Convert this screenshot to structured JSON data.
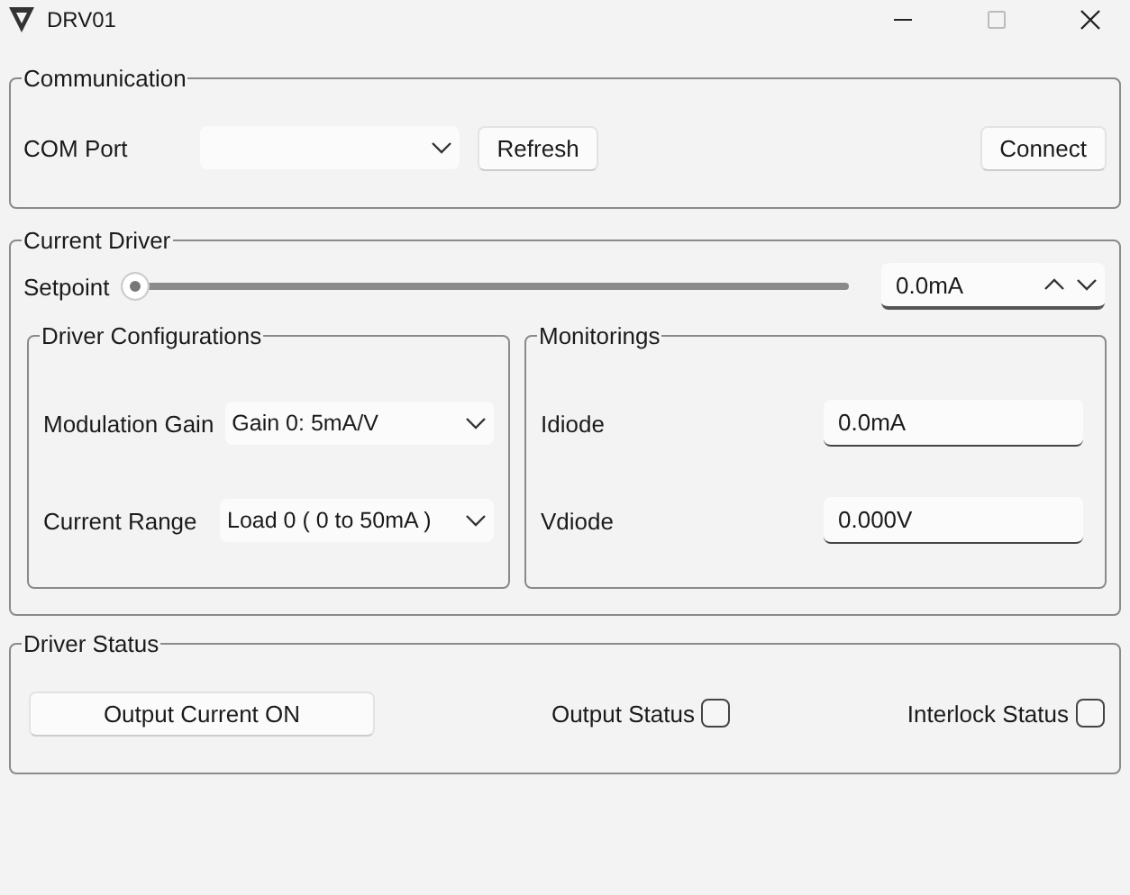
{
  "window": {
    "title": "DRV01"
  },
  "communication": {
    "title": "Communication",
    "com_port": {
      "label": "COM Port"
    },
    "refresh_button": "Refresh",
    "connect_button": "Connect"
  },
  "current_driver": {
    "title": "Current Driver",
    "setpoint": {
      "label": "Setpoint",
      "level": 0,
      "value": "0.0mA"
    },
    "driver_configurations": {
      "title": "Driver Configurations",
      "fields": [
        {
          "label": "Modulation Gain",
          "value": "Gain 0: 5mA/V"
        },
        {
          "label": "Current Range",
          "value": "Load 0 ( 0 to 50mA )"
        }
      ]
    },
    "monitorings": {
      "title": "Monitorings",
      "fields": [
        {
          "label": "Idiode",
          "value": "0.0mA"
        },
        {
          "label": "Vdiode",
          "value": "0.000V"
        }
      ]
    }
  },
  "driver_status": {
    "title": "Driver Status",
    "output_button": "Output Current ON",
    "indicators": [
      {
        "label": "Output Status",
        "checked": false
      },
      {
        "label": "Interlock Status",
        "checked": false
      }
    ]
  }
}
